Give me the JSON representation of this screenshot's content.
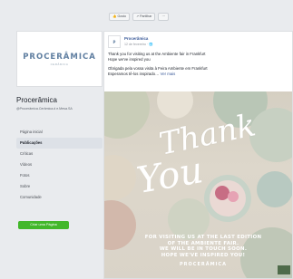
{
  "sidebar": {
    "logo_text": "PROCERÂMICA",
    "logo_sub": "CERÂMICA",
    "page_name": "Procerâmica",
    "page_handle": "@Procerâmica.Cerâmica.d e.Mesa.SA",
    "nav": [
      {
        "label": "Página inicial",
        "active": false
      },
      {
        "label": "Publicações",
        "active": true
      },
      {
        "label": "Críticas",
        "active": false
      },
      {
        "label": "Vídeos",
        "active": false
      },
      {
        "label": "Fotos",
        "active": false
      },
      {
        "label": "Sobre",
        "active": false
      },
      {
        "label": "Comunidade",
        "active": false
      }
    ],
    "create_page_label": "Criar uma Página"
  },
  "topbar": {
    "like_label": "👍 Gosto",
    "share_label": "↗ Partilhar",
    "more_label": "···"
  },
  "post": {
    "author": "Procerâmica",
    "date": "12 de fevereiro · 🌐",
    "text_en_1": "Thank you for visiting us at the Ambiente fair in Frankfurt",
    "text_en_2": "Hope we've inspired you",
    "text_pt_1": "Obrigada pela vossa visita à Feira Ambiente em Frankfurt",
    "text_pt_2": "Esperamos tê-los inspirado…",
    "see_more": "Ver mais",
    "image": {
      "thank": "Thank",
      "you": "You",
      "caption_1": "FOR VISITING US AT THE LAST EDITION",
      "caption_2": "OF THE AMBIENTE FAIR.",
      "caption_3": "WE WILL BE IN TOUCH SOON.",
      "caption_4": "HOPE WE'VE INSPIRED YOU!",
      "brand": "PROCERÂMICA"
    }
  },
  "colors": {
    "page_bg": "#e9ebee",
    "link": "#385898",
    "create_button": "#42b72a",
    "logo": "#5f7ea0"
  }
}
